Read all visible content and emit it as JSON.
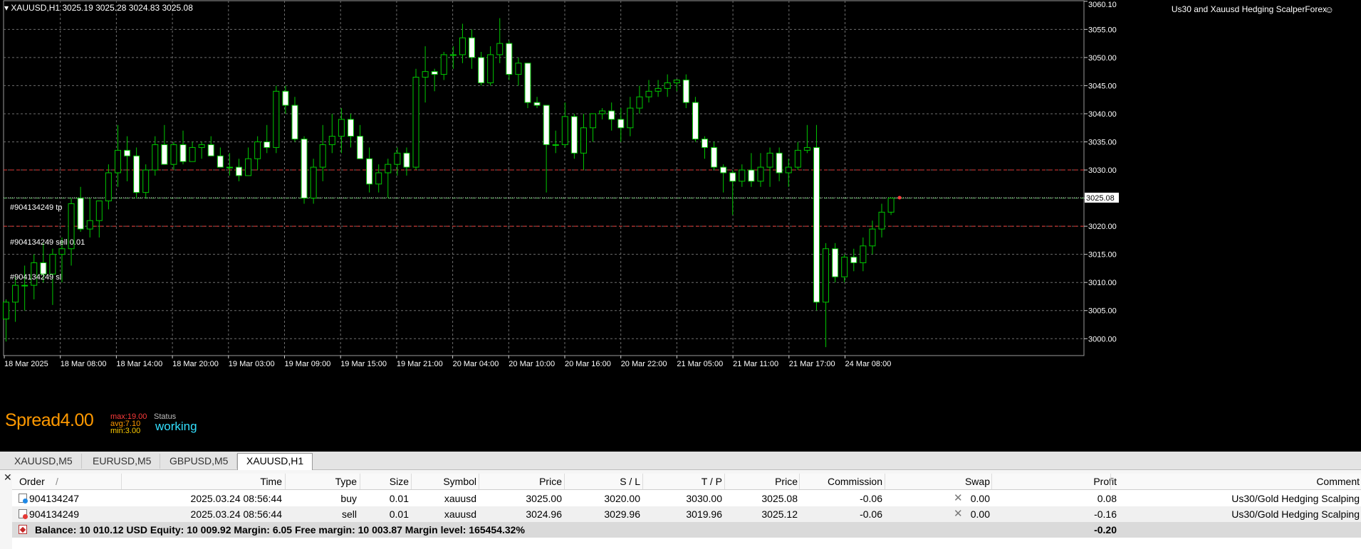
{
  "window": {
    "symbol_header": "▾ XAUUSD,H1  3025.19 3025.28 3024.83 3025.08",
    "ea_name": "Us30 and Xauusd Hedging ScalperForex",
    "smile_glyph": "☺"
  },
  "colors": {
    "background": "#000000",
    "grid": "#6e6e6e",
    "bull_candle": "#00c800",
    "bear_candle": "#ffffff",
    "tp_sl_line": "#e53935",
    "entry_line": "#43a047",
    "bid_line": "#cfcfcf",
    "spread_text": "#ff9900",
    "status_text": "#33e0ff"
  },
  "chart_data": {
    "type": "candlestick",
    "symbol": "XAUUSD",
    "timeframe": "H1",
    "ylim": [
      2997,
      3060.1
    ],
    "y_ticks": [
      3000,
      3005,
      3010,
      3015,
      3020,
      3025,
      3030,
      3035,
      3040,
      3045,
      3050,
      3055,
      3060
    ],
    "y_tick_labels": [
      "3000.00",
      "3005.00",
      "3010.00",
      "3015.00",
      "3020.00",
      "3025.00",
      "3030.00",
      "3035.00",
      "3040.00",
      "3045.00",
      "3050.00",
      "3055.00",
      "3060.10"
    ],
    "current_price": 3025.08,
    "current_price_label": "3025.08",
    "x_labels": [
      "18 Mar 2025",
      "18 Mar 08:00",
      "18 Mar 14:00",
      "18 Mar 20:00",
      "19 Mar 03:00",
      "19 Mar 09:00",
      "19 Mar 15:00",
      "19 Mar 21:00",
      "20 Mar 04:00",
      "20 Mar 10:00",
      "20 Mar 16:00",
      "20 Mar 22:00",
      "21 Mar 05:00",
      "21 Mar 11:00",
      "21 Mar 17:00",
      "24 Mar 08:00"
    ],
    "candles": [
      {
        "o": 3003.5,
        "h": 3007,
        "l": 2999.5,
        "c": 3006.5
      },
      {
        "o": 3006.5,
        "h": 3011,
        "l": 3003,
        "c": 3009.5
      },
      {
        "o": 3009.5,
        "h": 3013,
        "l": 3005,
        "c": 3009.5
      },
      {
        "o": 3009.5,
        "h": 3015,
        "l": 3007,
        "c": 3013.5
      },
      {
        "o": 3013.5,
        "h": 3017,
        "l": 3010,
        "c": 3011.5
      },
      {
        "o": 3011.5,
        "h": 3016,
        "l": 3006,
        "c": 3015
      },
      {
        "o": 3015,
        "h": 3018,
        "l": 3010,
        "c": 3016
      },
      {
        "o": 3016,
        "h": 3025,
        "l": 3013,
        "c": 3024
      },
      {
        "o": 3025,
        "h": 3027,
        "l": 3019,
        "c": 3019.5
      },
      {
        "o": 3019.5,
        "h": 3025,
        "l": 3018,
        "c": 3021
      },
      {
        "o": 3021,
        "h": 3024,
        "l": 3018,
        "c": 3024.5
      },
      {
        "o": 3024.5,
        "h": 3031,
        "l": 3023,
        "c": 3029.5
      },
      {
        "o": 3029.5,
        "h": 3038,
        "l": 3027,
        "c": 3033.5
      },
      {
        "o": 3033.5,
        "h": 3036,
        "l": 3028,
        "c": 3032.5
      },
      {
        "o": 3032.5,
        "h": 3034,
        "l": 3025,
        "c": 3026
      },
      {
        "o": 3026,
        "h": 3031,
        "l": 3025,
        "c": 3030
      },
      {
        "o": 3030,
        "h": 3036,
        "l": 3029,
        "c": 3034.5
      },
      {
        "o": 3034.5,
        "h": 3038,
        "l": 3032,
        "c": 3031
      },
      {
        "o": 3031,
        "h": 3035,
        "l": 3030,
        "c": 3034.5
      },
      {
        "o": 3034.5,
        "h": 3037,
        "l": 3031,
        "c": 3031.5
      },
      {
        "o": 3031.5,
        "h": 3035,
        "l": 3032,
        "c": 3034
      },
      {
        "o": 3034,
        "h": 3035,
        "l": 3032,
        "c": 3034.5
      },
      {
        "o": 3034.5,
        "h": 3036,
        "l": 3033,
        "c": 3032.5
      },
      {
        "o": 3032.5,
        "h": 3034,
        "l": 3031,
        "c": 3030.5
      },
      {
        "o": 3030.5,
        "h": 3033,
        "l": 3029,
        "c": 3030.5
      },
      {
        "o": 3030.5,
        "h": 3032,
        "l": 3028,
        "c": 3029
      },
      {
        "o": 3029,
        "h": 3034,
        "l": 3029,
        "c": 3032
      },
      {
        "o": 3032,
        "h": 3036,
        "l": 3030,
        "c": 3035
      },
      {
        "o": 3035,
        "h": 3038,
        "l": 3033,
        "c": 3034
      },
      {
        "o": 3034,
        "h": 3045,
        "l": 3033,
        "c": 3044
      },
      {
        "o": 3044,
        "h": 3045,
        "l": 3040,
        "c": 3041.5
      },
      {
        "o": 3041.5,
        "h": 3043,
        "l": 3035,
        "c": 3035.5
      },
      {
        "o": 3035.5,
        "h": 3036,
        "l": 3024,
        "c": 3025
      },
      {
        "o": 3025,
        "h": 3032,
        "l": 3024,
        "c": 3030.5
      },
      {
        "o": 3030.5,
        "h": 3038,
        "l": 3028,
        "c": 3034.5
      },
      {
        "o": 3034.5,
        "h": 3040,
        "l": 3033,
        "c": 3036
      },
      {
        "o": 3036,
        "h": 3041,
        "l": 3033,
        "c": 3039
      },
      {
        "o": 3039,
        "h": 3040,
        "l": 3034,
        "c": 3036
      },
      {
        "o": 3036,
        "h": 3038,
        "l": 3032,
        "c": 3032
      },
      {
        "o": 3032,
        "h": 3034,
        "l": 3026,
        "c": 3027.5
      },
      {
        "o": 3027.5,
        "h": 3031,
        "l": 3026,
        "c": 3029.5
      },
      {
        "o": 3029.5,
        "h": 3032,
        "l": 3025,
        "c": 3031
      },
      {
        "o": 3031,
        "h": 3034,
        "l": 3029,
        "c": 3033
      },
      {
        "o": 3033,
        "h": 3034,
        "l": 3029,
        "c": 3030.5
      },
      {
        "o": 3030.5,
        "h": 3048,
        "l": 3030,
        "c": 3046.5
      },
      {
        "o": 3046.5,
        "h": 3052,
        "l": 3042,
        "c": 3047.5
      },
      {
        "o": 3047.5,
        "h": 3048,
        "l": 3044,
        "c": 3047
      },
      {
        "o": 3047,
        "h": 3051,
        "l": 3046,
        "c": 3050.5
      },
      {
        "o": 3050.5,
        "h": 3052,
        "l": 3048,
        "c": 3050.5
      },
      {
        "o": 3050.5,
        "h": 3056,
        "l": 3049,
        "c": 3053.5
      },
      {
        "o": 3053.5,
        "h": 3055,
        "l": 3048,
        "c": 3050
      },
      {
        "o": 3050,
        "h": 3051,
        "l": 3045,
        "c": 3045.5
      },
      {
        "o": 3045.5,
        "h": 3052,
        "l": 3045,
        "c": 3050.5
      },
      {
        "o": 3050.5,
        "h": 3057,
        "l": 3049,
        "c": 3052.5
      },
      {
        "o": 3052.5,
        "h": 3053,
        "l": 3046,
        "c": 3047
      },
      {
        "o": 3047,
        "h": 3050,
        "l": 3045,
        "c": 3049
      },
      {
        "o": 3049,
        "h": 3049,
        "l": 3041,
        "c": 3042
      },
      {
        "o": 3042,
        "h": 3043,
        "l": 3041,
        "c": 3041.5
      },
      {
        "o": 3041.5,
        "h": 3041,
        "l": 3026,
        "c": 3034.5
      },
      {
        "o": 3034.5,
        "h": 3037,
        "l": 3033,
        "c": 3034.5
      },
      {
        "o": 3034.5,
        "h": 3042,
        "l": 3034,
        "c": 3039.5
      },
      {
        "o": 3039.5,
        "h": 3040,
        "l": 3032,
        "c": 3033
      },
      {
        "o": 3033,
        "h": 3040,
        "l": 3030,
        "c": 3037.5
      },
      {
        "o": 3037.5,
        "h": 3040,
        "l": 3035,
        "c": 3040
      },
      {
        "o": 3040,
        "h": 3041,
        "l": 3039,
        "c": 3040.5
      },
      {
        "o": 3040.5,
        "h": 3042,
        "l": 3037,
        "c": 3039
      },
      {
        "o": 3039,
        "h": 3041,
        "l": 3035,
        "c": 3037.5
      },
      {
        "o": 3037.5,
        "h": 3043,
        "l": 3036,
        "c": 3041
      },
      {
        "o": 3041,
        "h": 3045,
        "l": 3040,
        "c": 3043
      },
      {
        "o": 3043,
        "h": 3046,
        "l": 3042,
        "c": 3044
      },
      {
        "o": 3044,
        "h": 3046,
        "l": 3043,
        "c": 3044.5
      },
      {
        "o": 3044.5,
        "h": 3047,
        "l": 3043,
        "c": 3045.5
      },
      {
        "o": 3045.5,
        "h": 3046,
        "l": 3044,
        "c": 3046
      },
      {
        "o": 3046,
        "h": 3047,
        "l": 3041,
        "c": 3042
      },
      {
        "o": 3042,
        "h": 3043,
        "l": 3035,
        "c": 3035.5
      },
      {
        "o": 3035.5,
        "h": 3036,
        "l": 3032,
        "c": 3034
      },
      {
        "o": 3034,
        "h": 3035,
        "l": 3030,
        "c": 3030.5
      },
      {
        "o": 3030.5,
        "h": 3031,
        "l": 3026,
        "c": 3029.5
      },
      {
        "o": 3029.5,
        "h": 3030,
        "l": 3022,
        "c": 3028
      },
      {
        "o": 3028,
        "h": 3031,
        "l": 3027,
        "c": 3030
      },
      {
        "o": 3030,
        "h": 3033,
        "l": 3027,
        "c": 3028
      },
      {
        "o": 3028,
        "h": 3033,
        "l": 3027,
        "c": 3030.5
      },
      {
        "o": 3030.5,
        "h": 3034,
        "l": 3027,
        "c": 3033
      },
      {
        "o": 3033,
        "h": 3034,
        "l": 3028,
        "c": 3029.5
      },
      {
        "o": 3029.5,
        "h": 3032,
        "l": 3027,
        "c": 3030.5
      },
      {
        "o": 3030.5,
        "h": 3035,
        "l": 3030,
        "c": 3033.5
      },
      {
        "o": 3033.5,
        "h": 3038,
        "l": 3033,
        "c": 3034
      },
      {
        "o": 3034,
        "h": 3038,
        "l": 3005,
        "c": 3006.5
      },
      {
        "o": 3006.5,
        "h": 3017,
        "l": 2998.5,
        "c": 3016
      },
      {
        "o": 3016,
        "h": 3017,
        "l": 3010,
        "c": 3011
      },
      {
        "o": 3011,
        "h": 3015,
        "l": 3010,
        "c": 3014.5
      },
      {
        "o": 3014.5,
        "h": 3016,
        "l": 3012,
        "c": 3013.5
      },
      {
        "o": 3013.5,
        "h": 3018,
        "l": 3012,
        "c": 3016.5
      },
      {
        "o": 3016.5,
        "h": 3021,
        "l": 3015,
        "c": 3019.5
      },
      {
        "o": 3019.5,
        "h": 3024,
        "l": 3018,
        "c": 3022.5
      },
      {
        "o": 3022.5,
        "h": 3025,
        "l": 3022,
        "c": 3025
      }
    ],
    "order_lines": [
      {
        "label": "#904134249 tp",
        "price": 3030.0,
        "style": "tp"
      },
      {
        "label": "#904134249 sell 0.01",
        "price": 3025.0,
        "style": "entry"
      },
      {
        "label": "#904134249 sl",
        "price": 3020.0,
        "style": "tp"
      }
    ]
  },
  "indicator": {
    "spread_label": "Spread4.00",
    "max_label": "max:19.00",
    "avg_label": "avg:7.10",
    "min_label": "min:3.00",
    "status_label": "Status",
    "status_value": "working"
  },
  "tabs": [
    "XAUUSD,M5",
    "EURUSD,M5",
    "GBPUSD,M5",
    "XAUUSD,H1"
  ],
  "active_tab": 3,
  "terminal": {
    "close_glyph": "✕",
    "columns": {
      "order": "Order",
      "time": "Time",
      "type": "Type",
      "size": "Size",
      "symbol": "Symbol",
      "price": "Price",
      "sl": "S / L",
      "tp": "T / P",
      "price2": "Price",
      "commission": "Commission",
      "swap": "Swap",
      "profit": "Profit",
      "comment": "Comment"
    },
    "sort_glyph": "/",
    "rows": [
      {
        "order": "904134247",
        "time": "2025.03.24 08:56:44",
        "type": "buy",
        "size": "0.01",
        "symbol": "xauusd",
        "price": "3025.00",
        "sl": "3020.00",
        "tp": "3030.00",
        "price2": "3025.08",
        "commission": "-0.06",
        "swap": "0.00",
        "profit": "0.08",
        "comment": "Us30/Gold Hedging Scalping",
        "dot": "#1e88e5"
      },
      {
        "order": "904134249",
        "time": "2025.03.24 08:56:44",
        "type": "sell",
        "size": "0.01",
        "symbol": "xauusd",
        "price": "3024.96",
        "sl": "3029.96",
        "tp": "3019.96",
        "price2": "3025.12",
        "commission": "-0.06",
        "swap": "0.00",
        "profit": "-0.16",
        "comment": "Us30/Gold Hedging Scalping",
        "dot": "#e53935"
      }
    ],
    "balance_line": "Balance: 10 010.12 USD  Equity: 10 009.92  Margin: 6.05  Free margin: 10 003.87  Margin level: 165454.32%",
    "total_profit": "-0.20",
    "close_order_glyph": "✕"
  }
}
